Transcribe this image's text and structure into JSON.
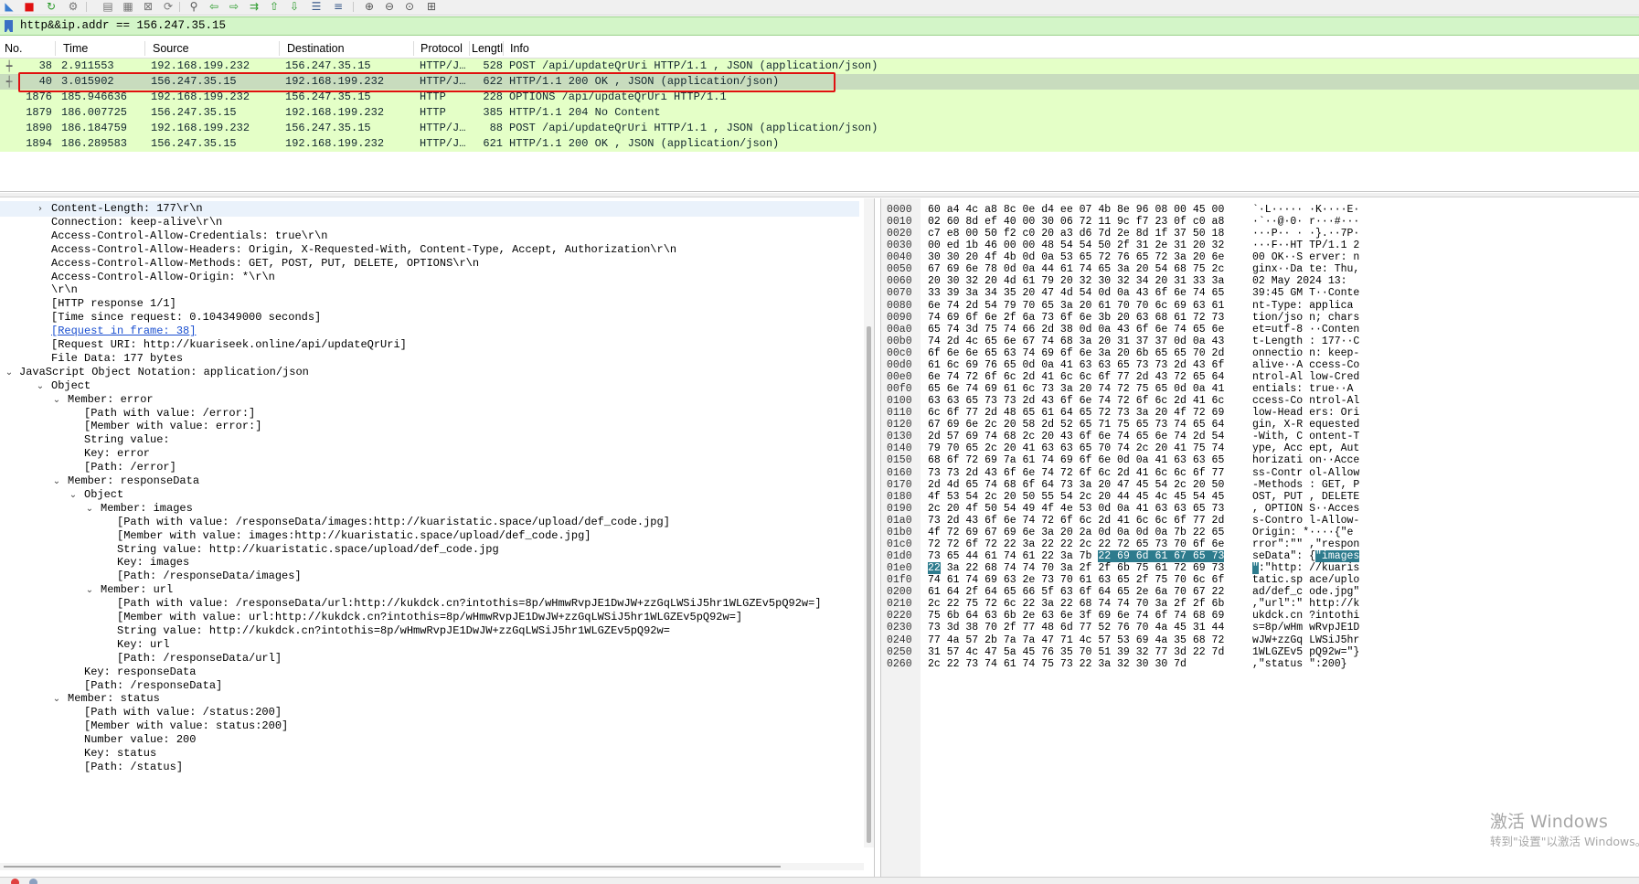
{
  "filter": {
    "value": "http&&ip.addr == 156.247.35.15"
  },
  "packet_list": {
    "headers": [
      "No.",
      "Time",
      "Source",
      "Destination",
      "Protocol",
      "Lengtl",
      "Info"
    ],
    "rows": [
      {
        "no": "38",
        "time": "2.911553",
        "src": "192.168.199.232",
        "dst": "156.247.35.15",
        "proto": "HTTP/J…",
        "len": "528",
        "info": "POST /api/updateQrUri HTTP/1.1 , JSON (application/json)",
        "rel": "┿",
        "selected": false
      },
      {
        "no": "40",
        "time": "3.015902",
        "src": "156.247.35.15",
        "dst": "192.168.199.232",
        "proto": "HTTP/J…",
        "len": "622",
        "info": "HTTP/1.1 200 OK , JSON (application/json)",
        "rel": "┽",
        "selected": true
      },
      {
        "no": "1876",
        "time": "185.946636",
        "src": "192.168.199.232",
        "dst": "156.247.35.15",
        "proto": "HTTP",
        "len": "228",
        "info": "OPTIONS /api/updateQrUri HTTP/1.1",
        "rel": "",
        "selected": false
      },
      {
        "no": "1879",
        "time": "186.007725",
        "src": "156.247.35.15",
        "dst": "192.168.199.232",
        "proto": "HTTP",
        "len": "385",
        "info": "HTTP/1.1 204 No Content",
        "rel": "",
        "selected": false
      },
      {
        "no": "1890",
        "time": "186.184759",
        "src": "192.168.199.232",
        "dst": "156.247.35.15",
        "proto": "HTTP/J…",
        "len": "88",
        "info": "POST /api/updateQrUri HTTP/1.1 , JSON (application/json)",
        "rel": "",
        "selected": false
      },
      {
        "no": "1894",
        "time": "186.289583",
        "src": "156.247.35.15",
        "dst": "192.168.199.232",
        "proto": "HTTP/J…",
        "len": "621",
        "info": "HTTP/1.1 200 OK , JSON (application/json)",
        "rel": "",
        "selected": false
      }
    ]
  },
  "details": {
    "lines": [
      {
        "indent": 2,
        "arrow": "›",
        "text": "Content-Length: 177\\r\\n",
        "hl": true
      },
      {
        "indent": 2,
        "arrow": "",
        "text": "Connection: keep-alive\\r\\n"
      },
      {
        "indent": 2,
        "arrow": "",
        "text": "Access-Control-Allow-Credentials: true\\r\\n"
      },
      {
        "indent": 2,
        "arrow": "",
        "text": "Access-Control-Allow-Headers: Origin, X-Requested-With, Content-Type, Accept, Authorization\\r\\n"
      },
      {
        "indent": 2,
        "arrow": "",
        "text": "Access-Control-Allow-Methods: GET, POST, PUT, DELETE, OPTIONS\\r\\n"
      },
      {
        "indent": 2,
        "arrow": "",
        "text": "Access-Control-Allow-Origin: *\\r\\n"
      },
      {
        "indent": 2,
        "arrow": "",
        "text": "\\r\\n"
      },
      {
        "indent": 2,
        "arrow": "",
        "text": "[HTTP response 1/1]"
      },
      {
        "indent": 2,
        "arrow": "",
        "text": "[Time since request: 0.104349000 seconds]"
      },
      {
        "indent": 2,
        "arrow": "",
        "text": "[Request in frame: 38]",
        "link": true
      },
      {
        "indent": 2,
        "arrow": "",
        "text": "[Request URI: http://kuariseek.online/api/updateQrUri]"
      },
      {
        "indent": 2,
        "arrow": "",
        "text": "File Data: 177 bytes"
      },
      {
        "indent": 1,
        "arrow": "⌄",
        "text": "JavaScript Object Notation: application/json"
      },
      {
        "indent": 2,
        "arrow": "⌄",
        "text": "Object"
      },
      {
        "indent": 3,
        "arrow": "⌄",
        "text": "Member: error"
      },
      {
        "indent": 4,
        "arrow": "",
        "text": "[Path with value: /error:]"
      },
      {
        "indent": 4,
        "arrow": "",
        "text": "[Member with value: error:]"
      },
      {
        "indent": 4,
        "arrow": "",
        "text": "String value:"
      },
      {
        "indent": 4,
        "arrow": "",
        "text": "Key: error"
      },
      {
        "indent": 4,
        "arrow": "",
        "text": "[Path: /error]"
      },
      {
        "indent": 3,
        "arrow": "⌄",
        "text": "Member: responseData"
      },
      {
        "indent": 4,
        "arrow": "⌄",
        "text": "Object"
      },
      {
        "indent": 5,
        "arrow": "⌄",
        "text": "Member: images"
      },
      {
        "indent": 6,
        "arrow": "",
        "text": "[Path with value: /responseData/images:http://kuaristatic.space/upload/def_code.jpg]"
      },
      {
        "indent": 6,
        "arrow": "",
        "text": "[Member with value: images:http://kuaristatic.space/upload/def_code.jpg]"
      },
      {
        "indent": 6,
        "arrow": "",
        "text": "String value: http://kuaristatic.space/upload/def_code.jpg"
      },
      {
        "indent": 6,
        "arrow": "",
        "text": "Key: images"
      },
      {
        "indent": 6,
        "arrow": "",
        "text": "[Path: /responseData/images]"
      },
      {
        "indent": 5,
        "arrow": "⌄",
        "text": "Member: url"
      },
      {
        "indent": 6,
        "arrow": "",
        "text": "[Path with value: /responseData/url:http://kukdck.cn?intothis=8p/wHmwRvpJE1DwJW+zzGqLWSiJ5hr1WLGZEv5pQ92w=]"
      },
      {
        "indent": 6,
        "arrow": "",
        "text": "[Member with value: url:http://kukdck.cn?intothis=8p/wHmwRvpJE1DwJW+zzGqLWSiJ5hr1WLGZEv5pQ92w=]"
      },
      {
        "indent": 6,
        "arrow": "",
        "text": "String value: http://kukdck.cn?intothis=8p/wHmwRvpJE1DwJW+zzGqLWSiJ5hr1WLGZEv5pQ92w="
      },
      {
        "indent": 6,
        "arrow": "",
        "text": "Key: url"
      },
      {
        "indent": 6,
        "arrow": "",
        "text": "[Path: /responseData/url]"
      },
      {
        "indent": 4,
        "arrow": "",
        "text": "Key: responseData"
      },
      {
        "indent": 4,
        "arrow": "",
        "text": "[Path: /responseData]"
      },
      {
        "indent": 3,
        "arrow": "⌄",
        "text": "Member: status"
      },
      {
        "indent": 4,
        "arrow": "",
        "text": "[Path with value: /status:200]"
      },
      {
        "indent": 4,
        "arrow": "",
        "text": "[Member with value: status:200]"
      },
      {
        "indent": 4,
        "arrow": "",
        "text": "Number value: 200"
      },
      {
        "indent": 4,
        "arrow": "",
        "text": "Key: status"
      },
      {
        "indent": 4,
        "arrow": "",
        "text": "[Path: /status]"
      }
    ]
  },
  "bytes": {
    "lines": [
      {
        "off": "0000",
        "hex": "60 a4 4c a8 8c 0e d4 ee  07 4b 8e 96 08 00 45 00",
        "asc": "`·L····· ·K····E·"
      },
      {
        "off": "0010",
        "hex": "02 60 8d ef 40 00 30 06  72 11 9c f7 23 0f c0 a8",
        "asc": "·`··@·0· r···#···"
      },
      {
        "off": "0020",
        "hex": "c7 e8 00 50 f2 c0 20 a3  d6 7d 2e 8d 1f 37 50 18",
        "asc": "···P·· · ·}.··7P·"
      },
      {
        "off": "0030",
        "hex": "00 ed 1b 46 00 00 48 54  54 50 2f 31 2e 31 20 32",
        "asc": "···F··HT TP/1.1 2"
      },
      {
        "off": "0040",
        "hex": "30 30 20 4f 4b 0d 0a 53  65 72 76 65 72 3a 20 6e",
        "asc": "00 OK··S erver: n"
      },
      {
        "off": "0050",
        "hex": "67 69 6e 78 0d 0a 44 61  74 65 3a 20 54 68 75 2c",
        "asc": "ginx··Da te: Thu,"
      },
      {
        "off": "0060",
        "hex": "20 30 32 20 4d 61 79 20  32 30 32 34 20 31 33 3a",
        "asc": " 02 May  2024 13:"
      },
      {
        "off": "0070",
        "hex": "33 39 3a 34 35 20 47 4d  54 0d 0a 43 6f 6e 74 65",
        "asc": "39:45 GM T··Conte"
      },
      {
        "off": "0080",
        "hex": "6e 74 2d 54 79 70 65 3a  20 61 70 70 6c 69 63 61",
        "asc": "nt-Type:  applica"
      },
      {
        "off": "0090",
        "hex": "74 69 6f 6e 2f 6a 73 6f  6e 3b 20 63 68 61 72 73",
        "asc": "tion/jso n; chars"
      },
      {
        "off": "00a0",
        "hex": "65 74 3d 75 74 66 2d 38  0d 0a 43 6f 6e 74 65 6e",
        "asc": "et=utf-8 ··Conten"
      },
      {
        "off": "00b0",
        "hex": "74 2d 4c 65 6e 67 74 68  3a 20 31 37 37 0d 0a 43",
        "asc": "t-Length : 177··C"
      },
      {
        "off": "00c0",
        "hex": "6f 6e 6e 65 63 74 69 6f  6e 3a 20 6b 65 65 70 2d",
        "asc": "onnectio n: keep-"
      },
      {
        "off": "00d0",
        "hex": "61 6c 69 76 65 0d 0a 41  63 63 65 73 73 2d 43 6f",
        "asc": "alive··A ccess-Co"
      },
      {
        "off": "00e0",
        "hex": "6e 74 72 6f 6c 2d 41 6c  6c 6f 77 2d 43 72 65 64",
        "asc": "ntrol-Al low-Cred"
      },
      {
        "off": "00f0",
        "hex": "65 6e 74 69 61 6c 73 3a  20 74 72 75 65 0d 0a 41",
        "asc": "entials:  true··A"
      },
      {
        "off": "0100",
        "hex": "63 63 65 73 73 2d 43 6f  6e 74 72 6f 6c 2d 41 6c",
        "asc": "ccess-Co ntrol-Al"
      },
      {
        "off": "0110",
        "hex": "6c 6f 77 2d 48 65 61 64  65 72 73 3a 20 4f 72 69",
        "asc": "low-Head ers: Ori"
      },
      {
        "off": "0120",
        "hex": "67 69 6e 2c 20 58 2d 52  65 71 75 65 73 74 65 64",
        "asc": "gin, X-R equested"
      },
      {
        "off": "0130",
        "hex": "2d 57 69 74 68 2c 20 43  6f 6e 74 65 6e 74 2d 54",
        "asc": "-With, C ontent-T"
      },
      {
        "off": "0140",
        "hex": "79 70 65 2c 20 41 63 63  65 70 74 2c 20 41 75 74",
        "asc": "ype, Acc ept, Aut"
      },
      {
        "off": "0150",
        "hex": "68 6f 72 69 7a 61 74 69  6f 6e 0d 0a 41 63 63 65",
        "asc": "horizati on··Acce"
      },
      {
        "off": "0160",
        "hex": "73 73 2d 43 6f 6e 74 72  6f 6c 2d 41 6c 6c 6f 77",
        "asc": "ss-Contr ol-Allow"
      },
      {
        "off": "0170",
        "hex": "2d 4d 65 74 68 6f 64 73  3a 20 47 45 54 2c 20 50",
        "asc": "-Methods : GET, P"
      },
      {
        "off": "0180",
        "hex": "4f 53 54 2c 20 50 55 54  2c 20 44 45 4c 45 54 45",
        "asc": "OST, PUT , DELETE"
      },
      {
        "off": "0190",
        "hex": "2c 20 4f 50 54 49 4f 4e  53 0d 0a 41 63 63 65 73",
        "asc": ", OPTION S··Acces"
      },
      {
        "off": "01a0",
        "hex": "73 2d 43 6f 6e 74 72 6f  6c 2d 41 6c 6c 6f 77 2d",
        "asc": "s-Contro l-Allow-"
      },
      {
        "off": "01b0",
        "hex": "4f 72 69 67 69 6e 3a 20  2a 0d 0a 0d 0a 7b 22 65",
        "asc": "Origin:  *····{\"e"
      },
      {
        "off": "01c0",
        "hex": "72 72 6f 72 22 3a 22 22  2c 22 72 65 73 70 6f 6e",
        "asc": "rror\":\"\" ,\"respon"
      },
      {
        "off": "01d0",
        "hex": "73 65 44 61 74 61 22 3a  7b ",
        "hexsel": "22 69 6d 61 67 65 73",
        "asc": "seData\": {",
        "ascsel": "\"images"
      },
      {
        "off": "01e0",
        "hex": "",
        "hexsel": "22",
        "hexrest": " 3a 22 68 74 74 70 3a  2f 2f 6b 75 61 72 69 73",
        "asc": "",
        "ascsel": "\"",
        "ascrest": ":\"http: //kuaris"
      },
      {
        "off": "01f0",
        "hex": "74 61 74 69 63 2e 73 70  61 63 65 2f 75 70 6c 6f",
        "asc": "tatic.sp ace/uplo"
      },
      {
        "off": "0200",
        "hex": "61 64 2f 64 65 66 5f 63  6f 64 65 2e 6a 70 67 22",
        "asc": "ad/def_c ode.jpg\""
      },
      {
        "off": "0210",
        "hex": "2c 22 75 72 6c 22 3a 22  68 74 74 70 3a 2f 2f 6b",
        "asc": ",\"url\":\" http://k"
      },
      {
        "off": "0220",
        "hex": "75 6b 64 63 6b 2e 63 6e  3f 69 6e 74 6f 74 68 69",
        "asc": "ukdck.cn ?intothi"
      },
      {
        "off": "0230",
        "hex": "73 3d 38 70 2f 77 48 6d  77 52 76 70 4a 45 31 44",
        "asc": "s=8p/wHm wRvpJE1D"
      },
      {
        "off": "0240",
        "hex": "77 4a 57 2b 7a 7a 47 71  4c 57 53 69 4a 35 68 72",
        "asc": "wJW+zzGq LWSiJ5hr"
      },
      {
        "off": "0250",
        "hex": "31 57 4c 47 5a 45 76 35  70 51 39 32 77 3d 22 7d",
        "asc": "1WLGZEv5 pQ92w=\"}"
      },
      {
        "off": "0260",
        "hex": "2c 22 73 74 61 74 75 73  22 3a 32 30 30 7d",
        "asc": ",\"status \":200}"
      }
    ]
  },
  "watermark": {
    "title": "激活 Windows",
    "sub": "转到\"设置\"以激活 Windows。"
  },
  "icons": [
    "shark-fin-icon",
    "stop-capture-icon",
    "restart-capture-icon",
    "capture-options-icon",
    "open-file-icon",
    "save-file-icon",
    "close-file-icon",
    "reload-file-icon",
    "find-packet-icon",
    "go-back-icon",
    "go-forward-icon",
    "go-to-packet-icon",
    "go-first-icon",
    "go-last-icon",
    "autoscroll-icon",
    "colorize-icon",
    "zoom-in-icon",
    "zoom-out-icon",
    "zoom-normal-icon",
    "resize-columns-icon"
  ]
}
